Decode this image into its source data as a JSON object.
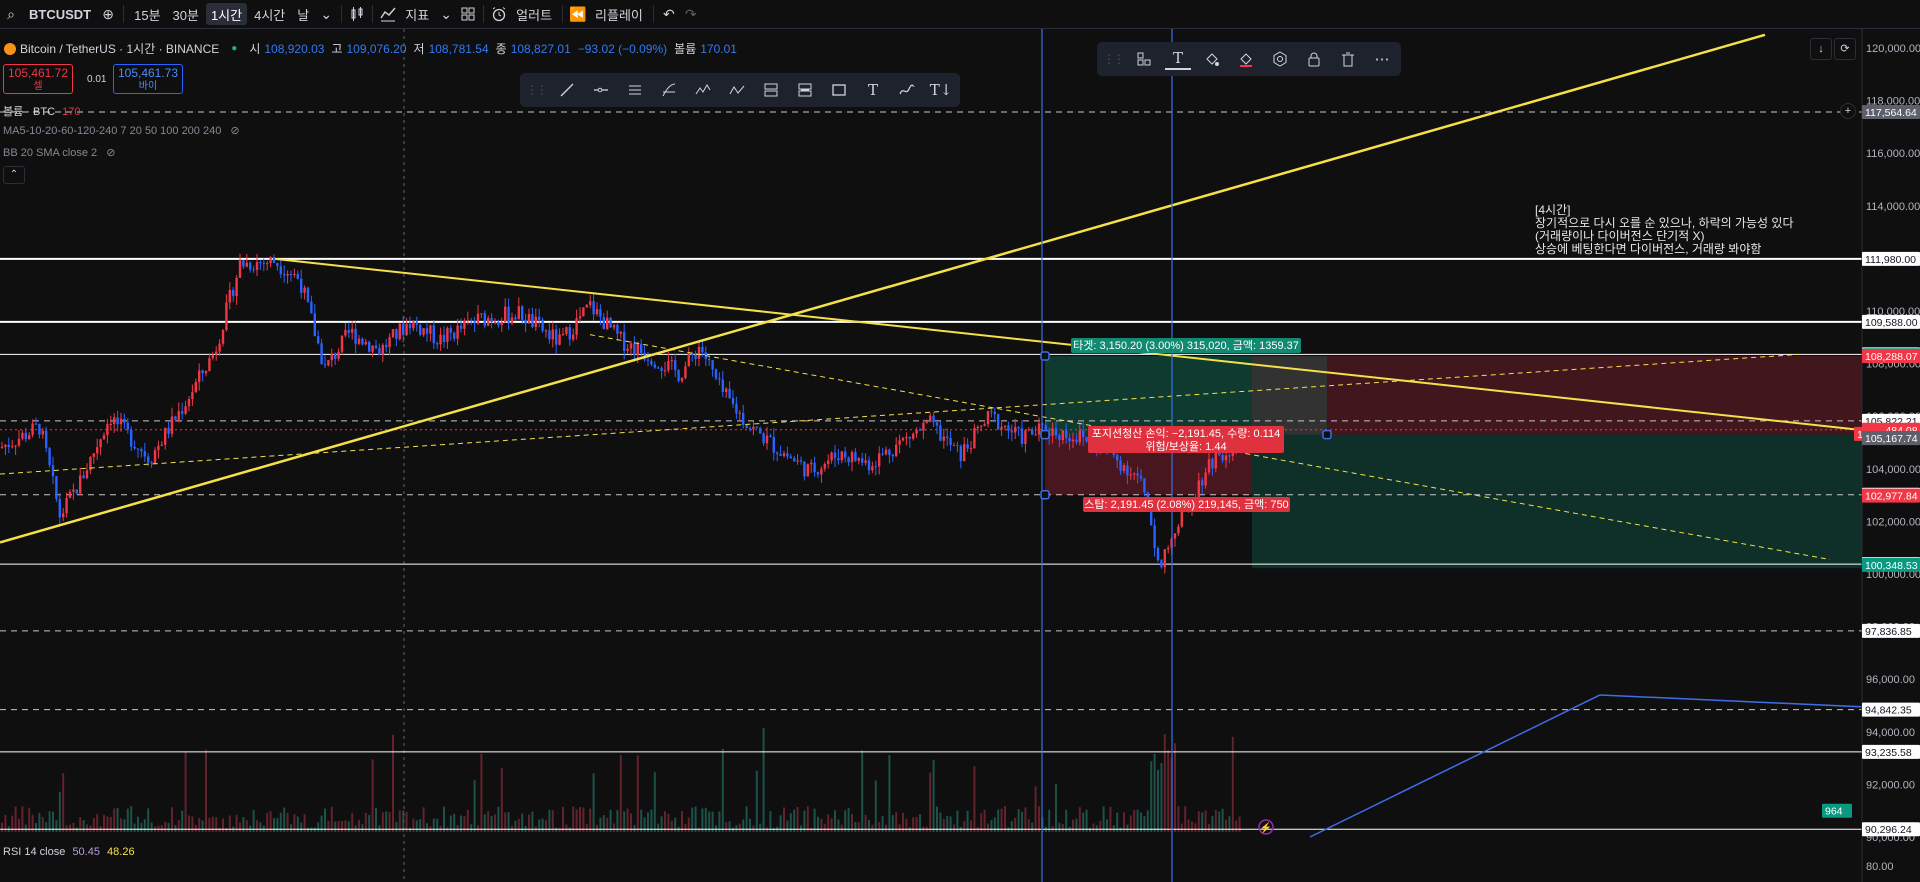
{
  "toolbar": {
    "symbol": "BTCUSDT",
    "add": "⊕",
    "intervals": [
      "15분",
      "30분",
      "1시간",
      "4시간",
      "날"
    ],
    "active_interval": "1시간",
    "indicators": "지표",
    "alerts": "얼러트",
    "replay": "리플레이"
  },
  "legend": {
    "title": "Bitcoin / TetherUS · 1시간 · BINANCE",
    "o_label": "시",
    "o": "108,920.03",
    "h_label": "고",
    "h": "109,076.20",
    "l_label": "저",
    "l": "108,781.54",
    "c_label": "종",
    "c": "108,827.01",
    "chg": "−93.02 (−0.09%)",
    "vol_label": "볼륨",
    "vol": "170.01"
  },
  "trade": {
    "sell_price": "105,461.72",
    "sell_label": "셀",
    "spread": "0.01",
    "buy_price": "105,461.73",
    "buy_label": "바이"
  },
  "indicators": {
    "volume": "볼륨 · BTC",
    "volume_val": "170",
    "ma": "MA5-10-20-60-120-240 7 20 50 100 200 240",
    "bb": "BB 20 SMA close 2"
  },
  "annotation": {
    "line1": "[4시간]",
    "line2": "장기적으로 다시 오를 순 있으나, 하락의 가능성 있다",
    "line3": "(거래량이나 다이버전스 단기적 X)",
    "line4": "상승에 베팅한다면 다이버전스, 거래량 봐야함"
  },
  "position": {
    "target": "타겟: 3,150.20 (3.00%) 315,020, 금액: 1359.37",
    "pnl": "포지션청산 손익: −2,191.45, 수량: 0.114",
    "rr": "위험/보상율: 1.44",
    "stop": "스탑: 2,191.45 (2.08%) 219,145, 금액: 750"
  },
  "rsi": {
    "label": "RSI 14 close",
    "v1": "50.45",
    "v2": "48.26"
  },
  "colors": {
    "up": "#f23645",
    "down": "#2962ff",
    "trend": "#f5e04a",
    "hline": "#ffffff",
    "target_zone": "#0f4d3f",
    "stop_zone": "#5c1a24"
  },
  "chart_data": {
    "type": "candlestick",
    "symbol": "BTCUSDT",
    "ylim": [
      89000,
      120500
    ],
    "y_ticks": [
      "120,000.00",
      "118,000.00",
      "116,000.00",
      "114,000.00",
      "112,000.00",
      "110,000.00",
      "108,000.00",
      "106,000.00",
      "104,000.00",
      "102,000.00",
      "100,000.00",
      "98,000.00",
      "96,000.00",
      "94,000.00",
      "92,000.00",
      "90,000.00"
    ],
    "price_labels": [
      {
        "text": "117,564.64",
        "price": 117564.64,
        "kind": "gray"
      },
      {
        "text": "111,980.00",
        "price": 111980.0,
        "kind": "white"
      },
      {
        "text": "109,588.00",
        "price": 109588.0,
        "kind": "white"
      },
      {
        "text": "108,353.00",
        "price": 108353.0,
        "kind": "white"
      },
      {
        "text": "108,319.49",
        "price": 108319.49,
        "kind": "green"
      },
      {
        "text": "108,288.07",
        "price": 108288.07,
        "kind": "red"
      },
      {
        "text": "105,822.21",
        "price": 105822.21,
        "kind": "white"
      },
      {
        "text": "105,484.08",
        "price": 105484.08,
        "kind": "red"
      },
      {
        "text": "11:50",
        "price": 105330,
        "kind": "red"
      },
      {
        "text": "105,169.29",
        "price": 105169.29,
        "kind": "gray"
      },
      {
        "text": "105,167.74",
        "price": 105167.74,
        "kind": "gray"
      },
      {
        "text": "103,012.08",
        "price": 103012.08,
        "kind": "white"
      },
      {
        "text": "102,977.84",
        "price": 102977.84,
        "kind": "red"
      },
      {
        "text": "100,373.95",
        "price": 100373.95,
        "kind": "white"
      },
      {
        "text": "100,348.53",
        "price": 100348.53,
        "kind": "green"
      },
      {
        "text": "97,836.85",
        "price": 97836.85,
        "kind": "white"
      },
      {
        "text": "94,842.35",
        "price": 94842.35,
        "kind": "white"
      },
      {
        "text": "93,235.58",
        "price": 93235.58,
        "kind": "white"
      },
      {
        "text": "90,296.24",
        "price": 90296.24,
        "kind": "white"
      },
      {
        "text": "964",
        "price": 91000,
        "kind": "green"
      }
    ],
    "bottom_tick": "80.00",
    "h_lines": [
      {
        "price": 117564.64,
        "style": "dashed"
      },
      {
        "price": 111980,
        "style": "solid-thick"
      },
      {
        "price": 109588,
        "style": "solid-thick"
      },
      {
        "price": 108353,
        "style": "solid"
      },
      {
        "price": 105822.21,
        "style": "dashed"
      },
      {
        "price": 103012.08,
        "style": "dashed"
      },
      {
        "price": 100373.95,
        "style": "solid"
      },
      {
        "price": 97836.85,
        "style": "dashed"
      },
      {
        "price": 94842.35,
        "style": "dashed"
      },
      {
        "price": 93235.58,
        "style": "solid"
      },
      {
        "price": 90296.24,
        "style": "solid"
      }
    ],
    "trend_lines": [
      {
        "from": [
          0,
          101200
        ],
        "to": [
          1765,
          120500
        ],
        "color": "#f5e04a",
        "width": 2.5
      },
      {
        "from": [
          275,
          111980
        ],
        "to": [
          1860,
          105480
        ],
        "color": "#f5e04a",
        "width": 2
      },
      {
        "from": [
          0,
          103800
        ],
        "to": [
          1800,
          108350
        ],
        "color": "#f5e04a",
        "width": 1,
        "dash": true
      },
      {
        "from": [
          590,
          109100
        ],
        "to": [
          1830,
          100550
        ],
        "color": "#f5e04a",
        "width": 1,
        "dash": true
      },
      {
        "from": [
          1310,
          90000
        ],
        "to": [
          1600,
          95400
        ],
        "color": "#3d6ee8",
        "width": 1.5
      },
      {
        "from": [
          1600,
          95400
        ],
        "to": [
          1920,
          94850
        ],
        "color": "#3d6ee8",
        "width": 1.5
      }
    ],
    "v_lines": [
      1042,
      1172
    ],
    "position": {
      "x1": 1045,
      "x2": 1327,
      "entry": 105300,
      "target": 108288,
      "stop": 103012
    }
  }
}
